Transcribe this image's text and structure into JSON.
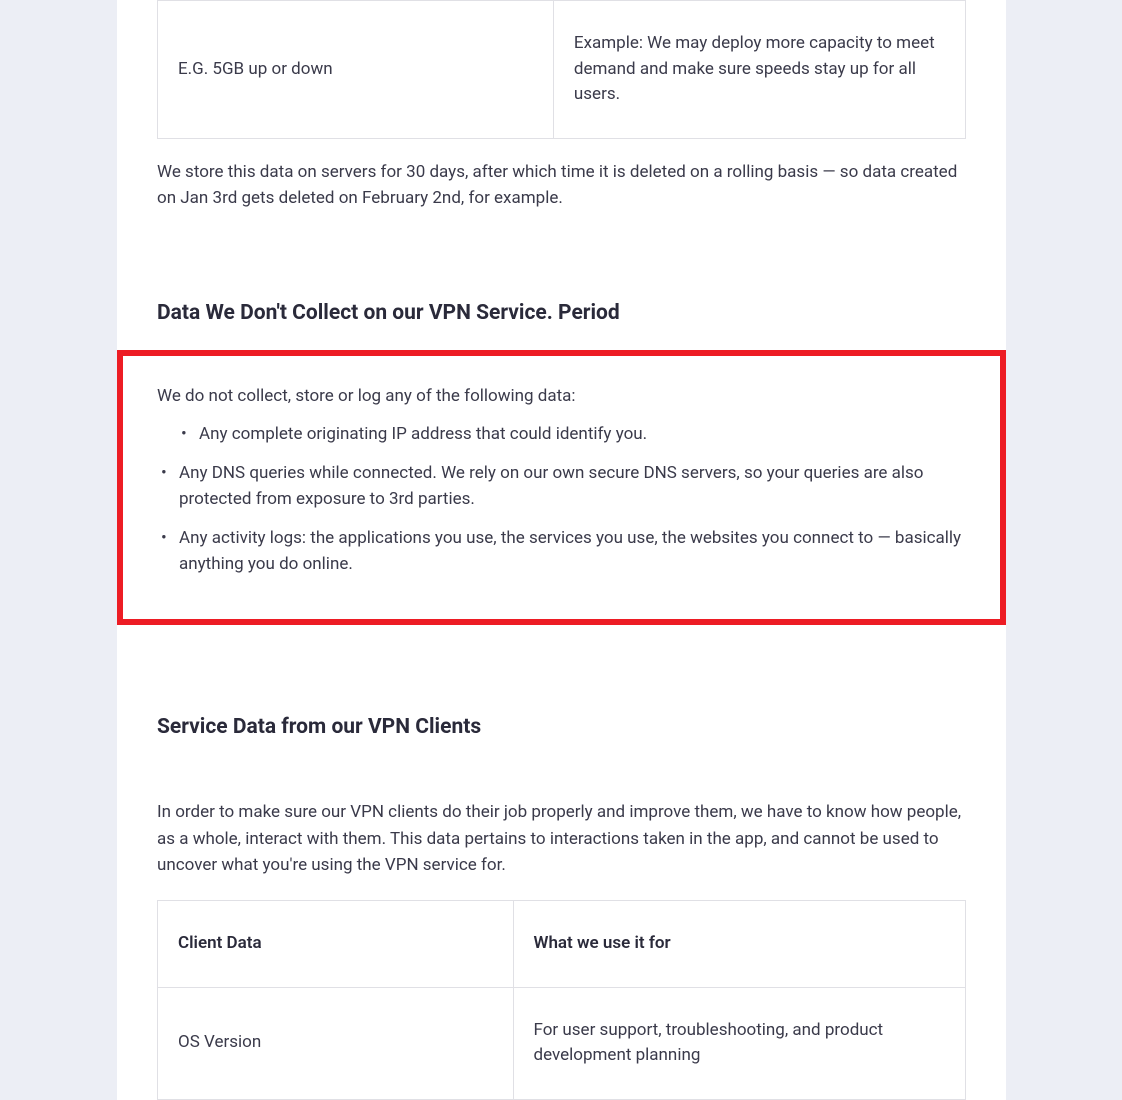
{
  "table1": {
    "row": {
      "col1": "E.G. 5GB up or down",
      "col2": "Example: We may deploy more capacity to meet demand and make sure speeds stay up for all users."
    }
  },
  "storage_paragraph": "We store this data on servers for 30 days, after which time it is deleted on a rolling basis — so data created on Jan 3rd gets deleted on February 2nd, for example.",
  "section1": {
    "heading": "Data We Don't Collect on our VPN Service. Period",
    "intro": "We do not collect, store or log any of the following data:",
    "items": {
      "0": "Any complete originating IP address that could identify you.",
      "1": "Any DNS queries while connected. We rely on our own secure DNS servers, so your queries are also protected from exposure to 3rd parties.",
      "2": "Any activity logs: the applications you use, the services you use, the websites you connect to — basically anything you do online."
    }
  },
  "section2": {
    "heading": "Service Data from our VPN Clients",
    "intro": "In order to make sure our VPN clients do their job properly and improve them, we have to know how people, as a whole, interact with them. This data pertains to interactions taken in the app, and cannot be used to uncover what you're using the VPN service for.",
    "table": {
      "header": {
        "col1": "Client Data",
        "col2": "What we use it for"
      },
      "row1": {
        "col1": "OS Version",
        "col2": "For user support, troubleshooting, and product development planning"
      }
    }
  }
}
